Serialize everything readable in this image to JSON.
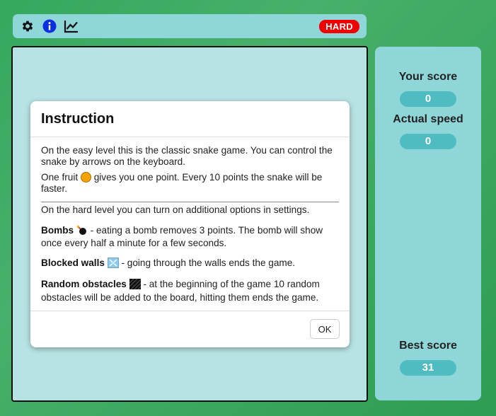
{
  "topbar": {
    "icons": [
      "gear-icon",
      "info-icon",
      "chart-icon"
    ],
    "difficulty": "HARD"
  },
  "side": {
    "score_label": "Your score",
    "score": "0",
    "speed_label": "Actual speed",
    "speed": "0",
    "best_label": "Best score",
    "best": "31"
  },
  "modal": {
    "title": "Instruction",
    "p1": "On the easy level this is the classic snake game. You can control the snake by arrows on the keyboard.",
    "p2a": "One fruit",
    "p2b": "gives you one point. Every 10 points the snake will be faster.",
    "p3": "On the hard level you can turn on additional options in settings.",
    "bombs_title": "Bombs",
    "bombs_text": "- eating a bomb removes 3 points. The bomb will show once every half a minute for a few seconds.",
    "walls_title": "Blocked walls",
    "walls_text": "- going through the walls ends the game.",
    "obst_title": "Random obstacles",
    "obst_text": "- at the beginning of the game 10 random obstacles will be added to the board, hitting them ends the game.",
    "ok_label": "OK"
  },
  "colors": {
    "accent": "#8fd6d8",
    "pill": "#4fbcc1",
    "badge": "#f10000"
  }
}
